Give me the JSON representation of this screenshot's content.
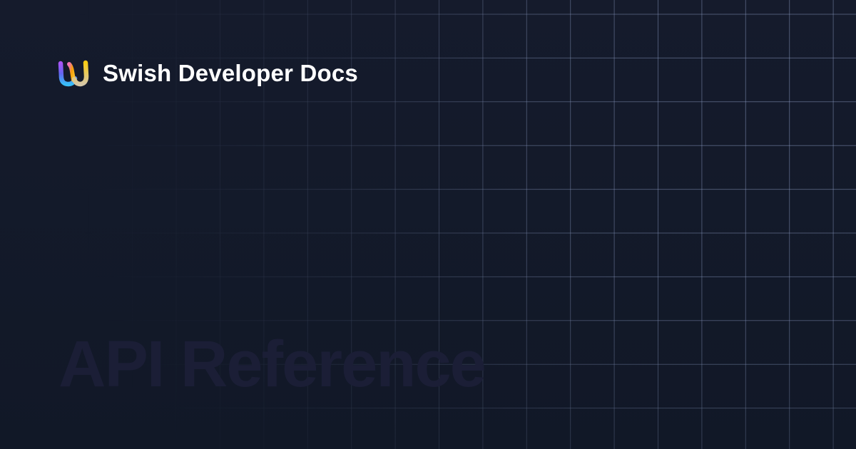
{
  "brand": {
    "name": "Swish Developer Docs",
    "logo_icon": "swish-logo-icon"
  },
  "page": {
    "heading": "API Reference"
  },
  "theme": {
    "background": "#131a2a",
    "heading_color": "#1b1e36",
    "grid_line_color": "#8fa0c8",
    "logo_colors": [
      "#8b5cf6",
      "#60a5fa",
      "#f59e0b",
      "#e9c28a"
    ]
  }
}
